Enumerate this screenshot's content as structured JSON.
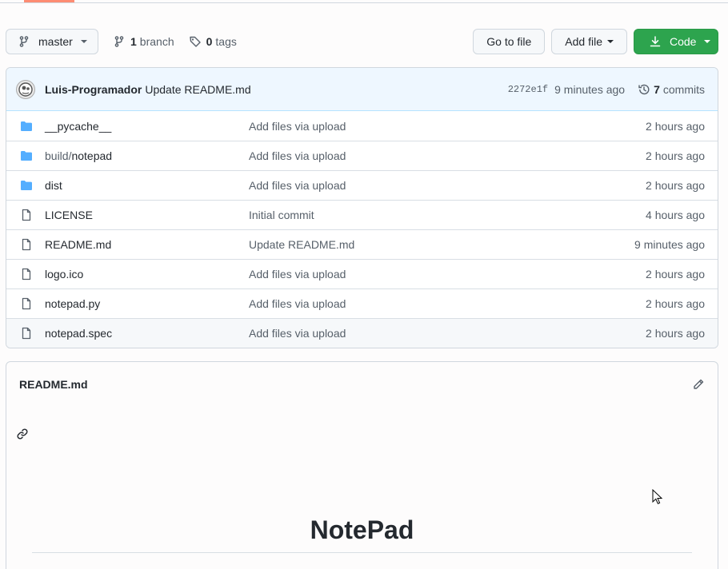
{
  "toolbar": {
    "branch": "master",
    "branch_count": "1",
    "branch_label": "branch",
    "tag_count": "0",
    "tag_label": "tags",
    "goto_label": "Go to file",
    "add_label": "Add file",
    "code_label": "Code"
  },
  "commit": {
    "author": "Luis-Programador",
    "message": "Update README.md",
    "sha": "2272e1f",
    "time": "9 minutes ago",
    "count": "7",
    "count_label": "commits"
  },
  "files": [
    {
      "prefix": "",
      "name": "__pycache__",
      "type": "folder",
      "message": "Add files via upload",
      "age": "2 hours ago"
    },
    {
      "prefix": "build/",
      "name": "notepad",
      "type": "folder",
      "message": "Add files via upload",
      "age": "2 hours ago"
    },
    {
      "prefix": "",
      "name": "dist",
      "type": "folder",
      "message": "Add files via upload",
      "age": "2 hours ago"
    },
    {
      "prefix": "",
      "name": "LICENSE",
      "type": "file",
      "message": "Initial commit",
      "age": "4 hours ago"
    },
    {
      "prefix": "",
      "name": "README.md",
      "type": "file",
      "message": "Update README.md",
      "age": "9 minutes ago"
    },
    {
      "prefix": "",
      "name": "logo.ico",
      "type": "file",
      "message": "Add files via upload",
      "age": "2 hours ago"
    },
    {
      "prefix": "",
      "name": "notepad.py",
      "type": "file",
      "message": "Add files via upload",
      "age": "2 hours ago"
    },
    {
      "prefix": "",
      "name": "notepad.spec",
      "type": "file",
      "message": "Add files via upload",
      "age": "2 hours ago"
    }
  ],
  "readme": {
    "title": "README.md",
    "heading": "NotePad"
  },
  "colors": {
    "accent_green": "#2da44e",
    "folder_blue": "#54aeff",
    "tab_underline": "#fd8c73"
  },
  "icons": [
    "branch-icon",
    "tag-icon",
    "download-icon",
    "history-icon",
    "folder-icon",
    "file-icon",
    "pencil-icon",
    "link-icon",
    "cursor-icon"
  ]
}
